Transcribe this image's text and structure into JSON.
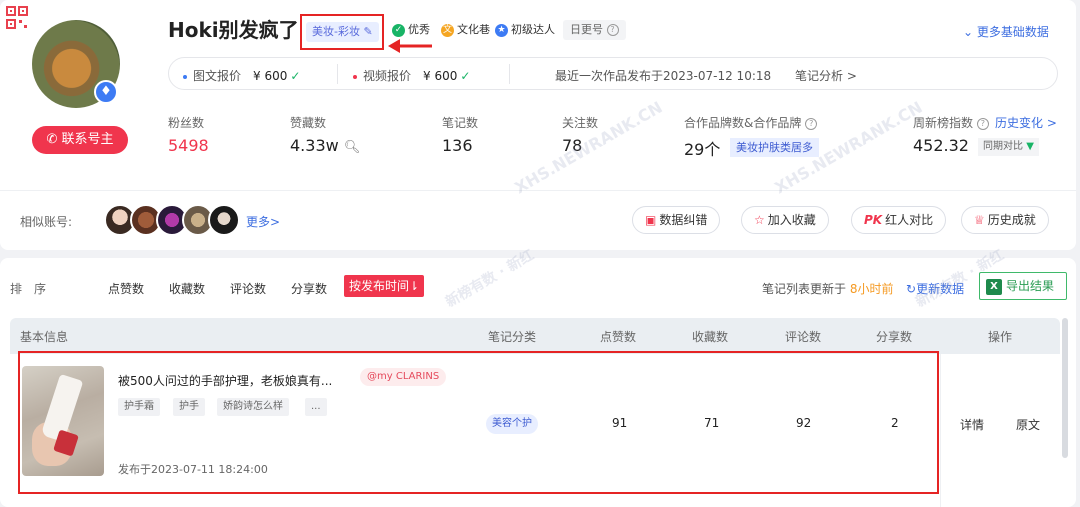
{
  "profile": {
    "name": "Hoki别发疯了",
    "category_tag": "美妆-彩妆",
    "badges": [
      {
        "icon": "shield-icon",
        "label": "优秀",
        "color": "#18b466"
      },
      {
        "icon": "culture-icon",
        "label": "文化巷",
        "color": "#f5a623"
      },
      {
        "icon": "level-icon",
        "label": "初级达人",
        "color": "#3d7bf4"
      }
    ],
    "daily_update": "日更号",
    "more_data_link": "更多基础数据",
    "contact_button": "联系号主"
  },
  "prices": {
    "image_text_label": "图文报价",
    "image_text_value": "¥ 600",
    "video_label": "视频报价",
    "video_value": "¥ 600",
    "last_publish": "最近一次作品发布于2023-07-12 10:18",
    "note_analysis": "笔记分析 >"
  },
  "stats": {
    "fans_label": "粉丝数",
    "fans_value": "5498",
    "likes_label": "赞藏数",
    "likes_value": "4.33w",
    "notes_label": "笔记数",
    "notes_value": "136",
    "following_label": "关注数",
    "following_value": "78",
    "brands_label": "合作品牌数&合作品牌",
    "brands_value": "29个",
    "brands_tag": "美妆护肤类居多",
    "weekly_label": "周新榜指数",
    "weekly_value": "452.32",
    "history_link": "历史变化 >",
    "yoy_label": "同期对比"
  },
  "similar": {
    "label": "相似账号:",
    "more": "更多>"
  },
  "actions": {
    "correct": "数据纠错",
    "favorite": "加入收藏",
    "compare": "红人对比",
    "achievements": "历史成就"
  },
  "sort_bar": {
    "label": "排　序",
    "items": [
      "点赞数",
      "收藏数",
      "评论数",
      "分享数"
    ],
    "active": "按发布时间⇂",
    "update_prefix": "笔记列表更新于",
    "update_time": "8小时前",
    "refresh": "更新数据",
    "export": "导出结果"
  },
  "table": {
    "headers": {
      "basic": "基本信息",
      "category": "笔记分类",
      "likes": "点赞数",
      "favorites": "收藏数",
      "comments": "评论数",
      "shares": "分享数",
      "ops": "操作"
    },
    "rows": [
      {
        "title": "被500人问过的手部护理，老板娘真有...",
        "brand": "@my CLARINS",
        "keywords": [
          "护手霜",
          "护手",
          "娇韵诗怎么样",
          "..."
        ],
        "published": "发布于2023-07-11 18:24:00",
        "category": "美容个护",
        "likes": "91",
        "favorites": "71",
        "comments": "92",
        "shares": "2",
        "detail": "详情",
        "original": "原文"
      }
    ]
  },
  "watermark": "XHS.NEWRANK.CN",
  "watermark2": "新榜有数 · 新红",
  "colors": {
    "accent_red": "#f0354d",
    "link_blue": "#3d6ee0",
    "highlight_box": "#e52424",
    "tag_blue_bg": "#e8eeff"
  }
}
